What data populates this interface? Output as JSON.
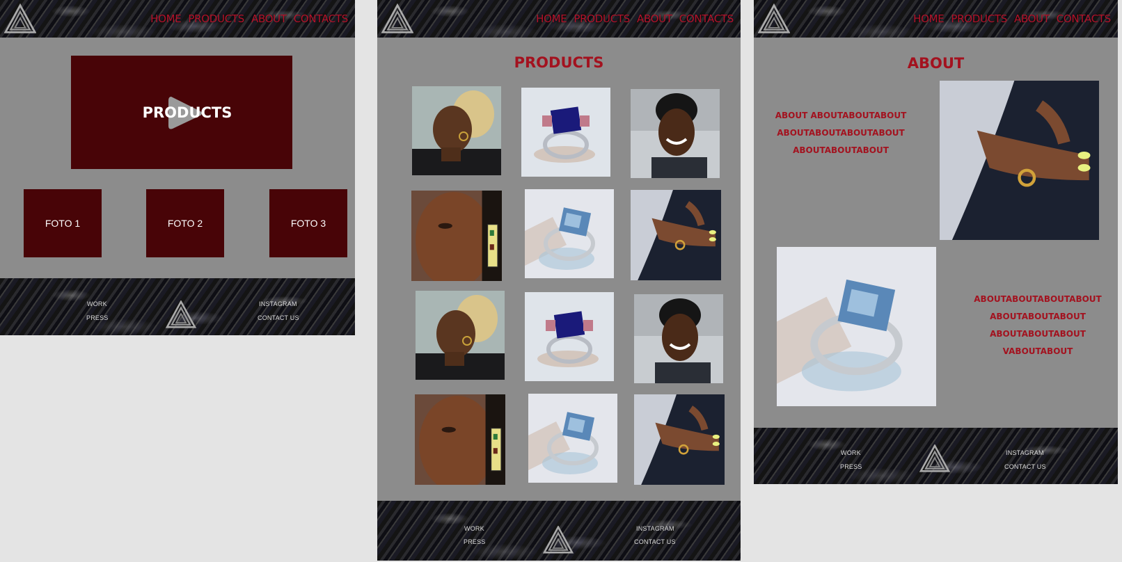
{
  "nav": {
    "home": "HOME",
    "products": "PRODUCTS",
    "about": "ABOUT",
    "contacts": "CONTACTS"
  },
  "footer": {
    "work": "WORK",
    "press": "PRESS",
    "instagram": "INSTAGRAM",
    "contact": "CONTACT US"
  },
  "home": {
    "hero_label": "PRODUCTS",
    "foto1": "FOTO 1",
    "foto2": "FOTO 2",
    "foto3": "FOTO 3"
  },
  "products": {
    "title": "PRODUCTS"
  },
  "about": {
    "title": "ABOUT",
    "text1": [
      "ABOUT ABOUTABOUTABOUT",
      "ABOUTABOUTABOUTABOUT",
      "ABOUTABOUTABOUT"
    ],
    "text2": [
      "ABOUTABOUTABOUTABOUT",
      "ABOUTABOUTABOUT",
      "ABOUTABOUTABOUT",
      "VABOUTABOUT"
    ]
  },
  "colors": {
    "accent": "#a3121f",
    "box": "#480407",
    "page_bg": "#8c8c8c"
  }
}
